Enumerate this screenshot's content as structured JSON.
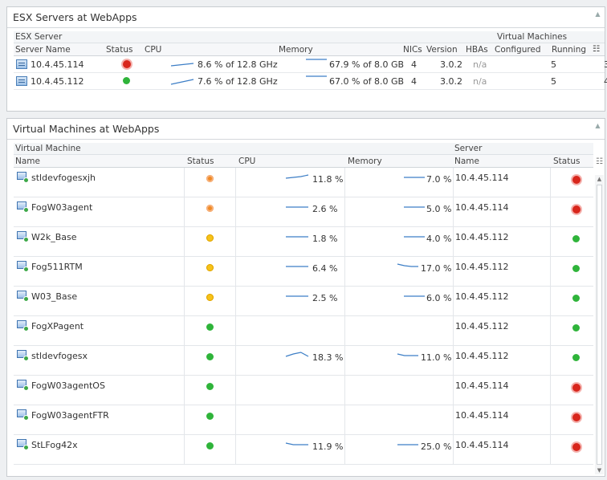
{
  "esx_panel": {
    "title": "ESX Servers at WebApps",
    "group_labels": {
      "esx_server": "ESX Server",
      "virtual_machines": "Virtual Machines"
    },
    "headers": {
      "server_name": "Server Name",
      "status": "Status",
      "cpu": "CPU",
      "memory": "Memory",
      "nics": "NICs",
      "version": "Version",
      "hbas": "HBAs",
      "configured": "Configured",
      "running": "Running"
    },
    "rows": [
      {
        "name": "10.4.45.114",
        "status": "red",
        "cpu": "8.6 % of 12.8 GHz",
        "memory": "67.9 % of 8.0 GB",
        "nics": "4",
        "version": "3.0.2",
        "hbas": "n/a",
        "configured": "5",
        "running": "3"
      },
      {
        "name": "10.4.45.112",
        "status": "green",
        "cpu": "7.6 % of 12.8 GHz",
        "memory": "67.0 % of 8.0 GB",
        "nics": "4",
        "version": "3.0.2",
        "hbas": "n/a",
        "configured": "5",
        "running": "4"
      }
    ]
  },
  "vm_panel": {
    "title": "Virtual Machines at WebApps",
    "group_labels": {
      "virtual_machine": "Virtual Machine",
      "server": "Server"
    },
    "headers": {
      "name": "Name",
      "status": "Status",
      "cpu": "CPU",
      "memory": "Memory",
      "server_name": "Name",
      "server_status": "Status"
    },
    "rows": [
      {
        "name": "stldevfogesxjh",
        "status": "orange",
        "cpu": "11.8 %",
        "memory": "7.0 %",
        "server": "10.4.45.114",
        "server_status": "red"
      },
      {
        "name": "FogW03agent",
        "status": "orange",
        "cpu": "2.6 %",
        "memory": "5.0 %",
        "server": "10.4.45.114",
        "server_status": "red"
      },
      {
        "name": "W2k_Base",
        "status": "yellow",
        "cpu": "1.8 %",
        "memory": "4.0 %",
        "server": "10.4.45.112",
        "server_status": "green"
      },
      {
        "name": "Fog511RTM",
        "status": "yellow",
        "cpu": "6.4 %",
        "memory": "17.0 %",
        "server": "10.4.45.112",
        "server_status": "green"
      },
      {
        "name": "W03_Base",
        "status": "yellow",
        "cpu": "2.5 %",
        "memory": "6.0 %",
        "server": "10.4.45.112",
        "server_status": "green"
      },
      {
        "name": "FogXPagent",
        "status": "green",
        "cpu": "",
        "memory": "",
        "server": "10.4.45.112",
        "server_status": "green"
      },
      {
        "name": "stldevfogesx",
        "status": "green",
        "cpu": "18.3 %",
        "memory": "11.0 %",
        "server": "10.4.45.112",
        "server_status": "green"
      },
      {
        "name": "FogW03agentOS",
        "status": "green",
        "cpu": "",
        "memory": "",
        "server": "10.4.45.114",
        "server_status": "red"
      },
      {
        "name": "FogW03agentFTR",
        "status": "green",
        "cpu": "",
        "memory": "",
        "server": "10.4.45.114",
        "server_status": "red"
      },
      {
        "name": "StLFog42x",
        "status": "green",
        "cpu": "11.9 %",
        "memory": "25.0 %",
        "server": "10.4.45.114",
        "server_status": "red"
      }
    ]
  },
  "colors": {
    "sparkline": "#3c7ec6",
    "green": "#2fb43a",
    "red": "#d8261c",
    "orange": "#f08a24",
    "yellow": "#f6c21a"
  },
  "icons": {
    "server": "server-icon",
    "vm": "vm-icon",
    "column_chooser": "column-chooser-icon",
    "collapse": "collapse-icon"
  }
}
